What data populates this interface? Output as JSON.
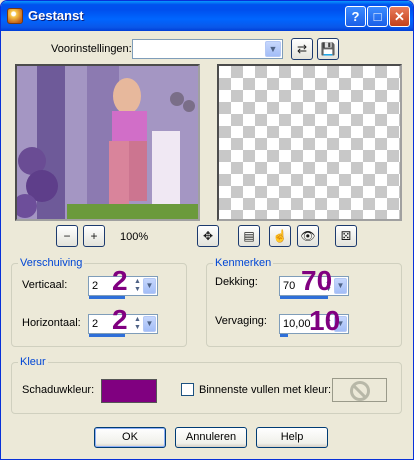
{
  "window": {
    "title": "Gestanst"
  },
  "titlebar": {
    "help": "?",
    "maximize": "□",
    "close": "✕"
  },
  "presets": {
    "label": "Voorinstellingen:",
    "value": ""
  },
  "preview": {
    "zoom": "100%"
  },
  "offset": {
    "title": "Verschuiving",
    "vertical_label": "Verticaal:",
    "vertical_value": "2",
    "vertical_overlay": "2",
    "horizontal_label": "Horizontaal:",
    "horizontal_value": "2",
    "horizontal_overlay": "2"
  },
  "properties": {
    "title": "Kenmerken",
    "opacity_label": "Dekking:",
    "opacity_value": "70",
    "opacity_overlay": "70",
    "blur_label": "Vervaging:",
    "blur_value": "10,00",
    "blur_overlay": "10"
  },
  "color": {
    "title": "Kleur",
    "shadow_label": "Schaduwkleur:",
    "shadow_color": "#800080",
    "fill_label": "Binnenste vullen met kleur:",
    "fill_checked": false
  },
  "buttons": {
    "ok": "OK",
    "cancel": "Annuleren",
    "help": "Help"
  },
  "colors": {
    "accent": "#0046d5",
    "overlay": "#800080"
  }
}
